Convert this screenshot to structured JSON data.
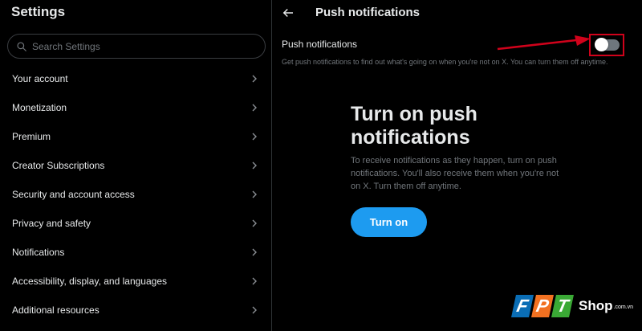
{
  "sidebar": {
    "title": "Settings",
    "search_placeholder": "Search Settings",
    "items": [
      {
        "label": "Your account"
      },
      {
        "label": "Monetization"
      },
      {
        "label": "Premium"
      },
      {
        "label": "Creator Subscriptions"
      },
      {
        "label": "Security and account access"
      },
      {
        "label": "Privacy and safety"
      },
      {
        "label": "Notifications"
      },
      {
        "label": "Accessibility, display, and languages"
      },
      {
        "label": "Additional resources"
      }
    ]
  },
  "main": {
    "title": "Push notifications",
    "setting_label": "Push notifications",
    "setting_description": "Get push notifications to find out what's going on when you're not on X. You can turn them off anytime.",
    "toggle_on": false,
    "promo_title": "Turn on push notifications",
    "promo_description": "To receive notifications as they happen, turn on push notifications. You'll also receive them when you're not on X. Turn them off anytime.",
    "turn_on_label": "Turn on"
  },
  "watermark": {
    "letters": [
      "F",
      "P",
      "T"
    ],
    "shop": "Shop",
    "domain": ".com.vn"
  },
  "colors": {
    "accent": "#1d9bf0",
    "highlight": "#d0021b",
    "fpt_blue": "#0a6db5",
    "fpt_orange": "#f27121",
    "fpt_green": "#3aa935"
  },
  "icons": {
    "search": "search-icon",
    "back": "back-arrow-icon",
    "chevron": "chevron-right-icon"
  }
}
